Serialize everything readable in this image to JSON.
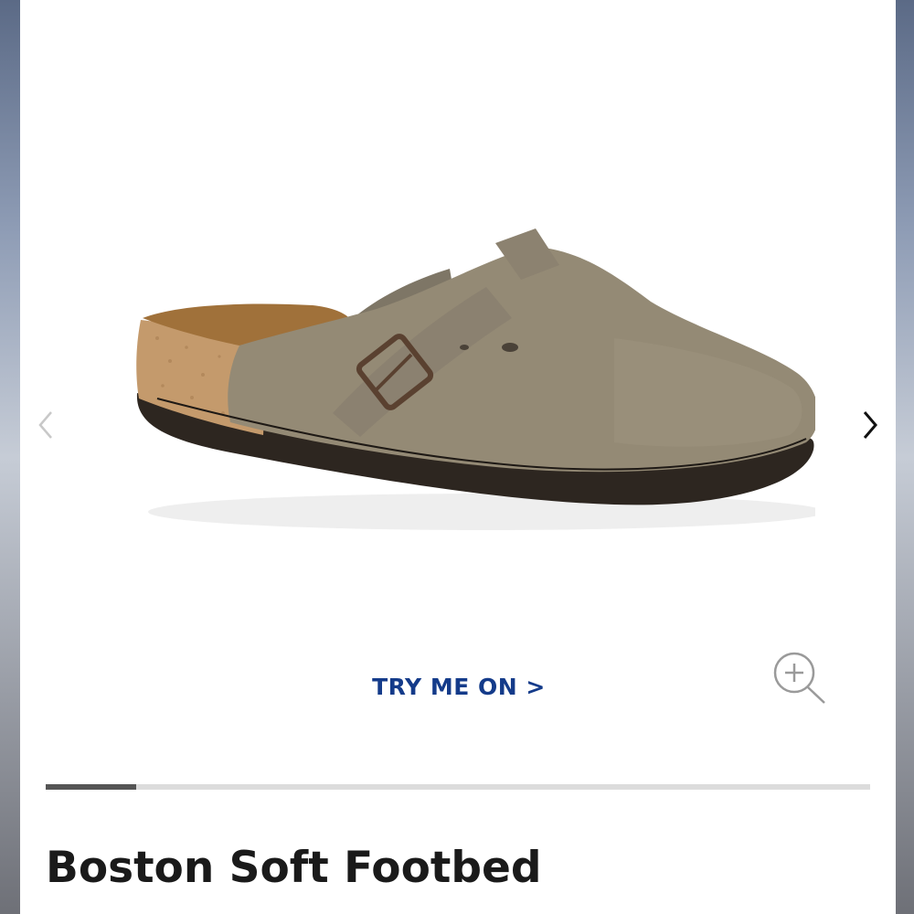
{
  "gallery": {
    "image_alt": "Boston Soft Footbed",
    "prev_icon": "chevron-left-icon",
    "next_icon": "chevron-right-icon",
    "zoom_icon": "zoom-in-icon",
    "try_on_label": "TRY ME ON >",
    "progress": 0.11
  },
  "product": {
    "title": "Boston Soft Footbed"
  },
  "colors": {
    "accent": "#143b8a",
    "title": "#1a1a1a",
    "progress_track": "#dcdcdc",
    "progress_fill": "#555555"
  }
}
